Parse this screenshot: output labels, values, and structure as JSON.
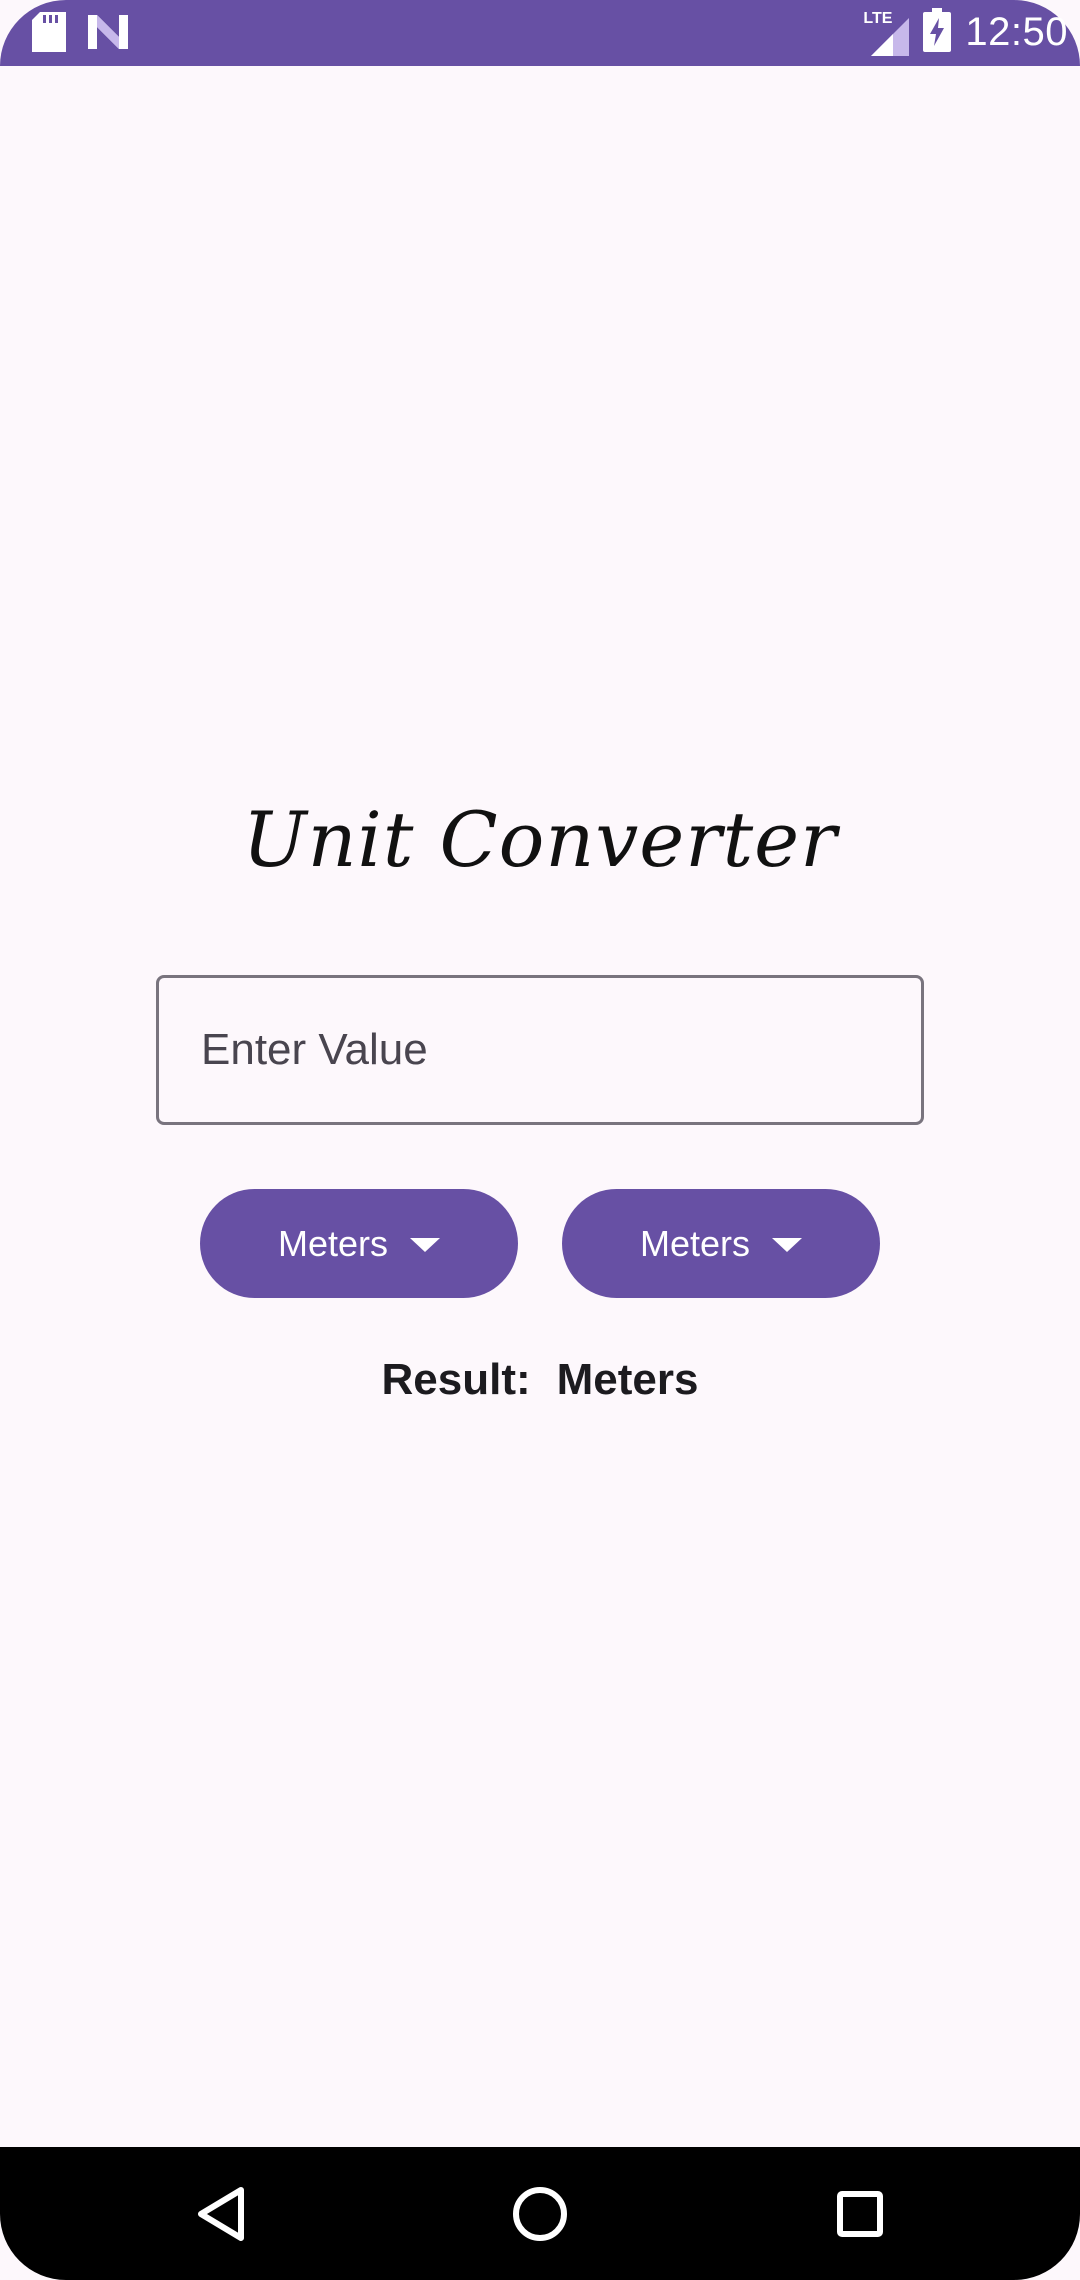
{
  "status_bar": {
    "time": "12:50",
    "network_label": "LTE",
    "left_icons": [
      "sd-card-icon",
      "n-logo-icon"
    ],
    "right_icons": [
      "signal-icon",
      "battery-charging-icon"
    ],
    "color": "#6750a4"
  },
  "app": {
    "title": "Unit Converter",
    "value_input": {
      "placeholder": "Enter Value",
      "value": ""
    },
    "from_unit": {
      "label": "Meters",
      "icon": "arrow-drop-down-icon"
    },
    "to_unit": {
      "label": "Meters",
      "icon": "arrow-drop-down-icon"
    },
    "result": {
      "label": "Result:",
      "value": "Meters"
    },
    "accent_color": "#6750a4",
    "background_color": "#fdf8fc"
  },
  "nav_bar": {
    "buttons": [
      "back-icon",
      "home-icon",
      "recents-icon"
    ]
  }
}
